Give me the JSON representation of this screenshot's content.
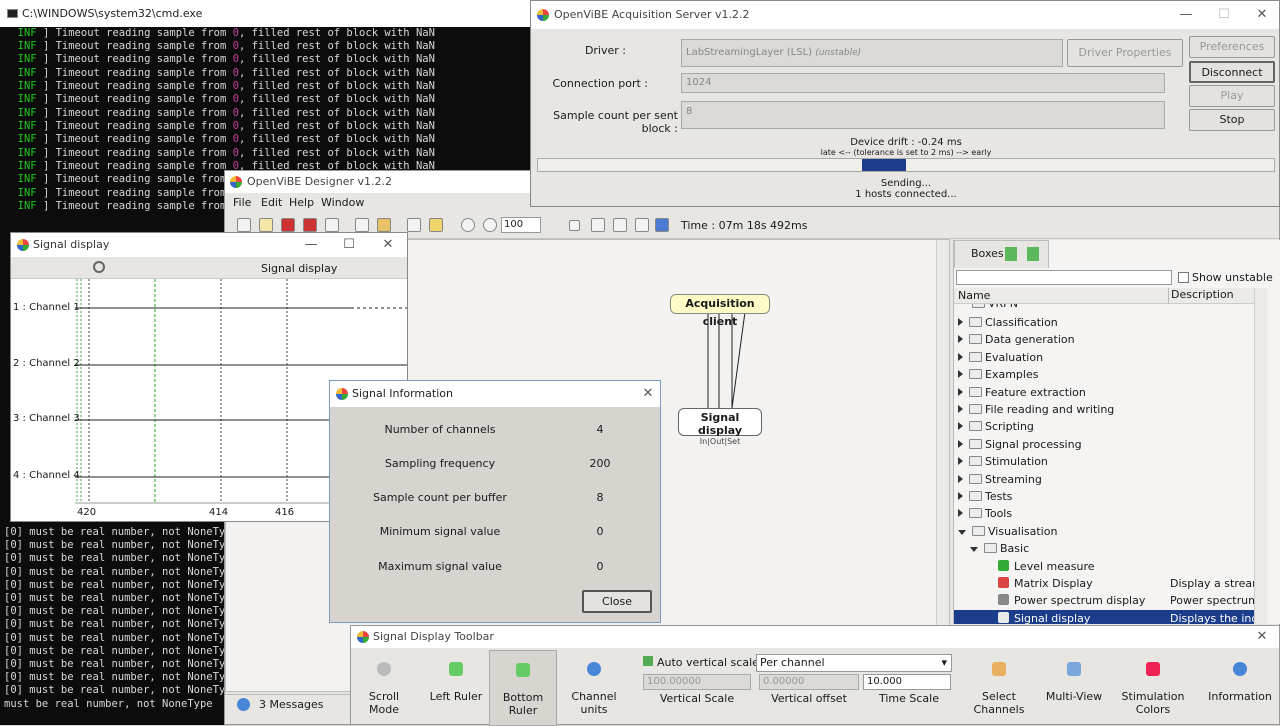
{
  "cmd": {
    "title": "C:\\WINDOWS\\system32\\cmd.exe",
    "inf_lines": [
      "INF",
      "INF",
      "INF",
      "INF",
      "INF",
      "INF",
      "INF",
      "INF",
      "INF",
      "INF",
      "INF",
      "INF",
      "INF",
      "INF"
    ],
    "inf_text_prefix": "] Timeout reading sample from ",
    "inf_text_num": "0",
    "inf_text_suffix": ", filled rest of block with NaN",
    "short_text": "] Timeout reading sample from",
    "err_lines": [
      "[0] must be real number, not NoneType",
      "[0] must be real number, not NoneType",
      "[0] must be real number, not NoneType",
      "[0] must be real number, not NoneType",
      "[0] must be real number, not NoneType",
      "[0] must be real number, not NoneType",
      "[0] must be real number, not NoneType",
      "[0] must be real number, not NoneType",
      "[0] must be real number, not NoneType",
      "[0] must be real number, not NoneType",
      "[0] must be real number, not NoneType",
      "[0] must be real number, not NoneType",
      "[0] must be real number, not NoneType"
    ],
    "last_line": "must be real number, not NoneType"
  },
  "acq": {
    "title": "OpenViBE Acquisition Server v1.2.2",
    "driver_label": "Driver :",
    "driver_value": "LabStreamingLayer (LSL)",
    "driver_tag": "(unstable)",
    "driver_props": "Driver Properties",
    "port_label": "Connection port :",
    "port_value": "1024",
    "sample_label": "Sample count per sent block :",
    "sample_value": "8",
    "preferences": "Preferences",
    "disconnect": "Disconnect",
    "play": "Play",
    "stop": "Stop",
    "drift": "Device drift : -0.24 ms",
    "tolerance": "late <-- (tolerance is set to 2 ms) --> early",
    "sending": "Sending...",
    "hosts": "1 hosts connected..."
  },
  "designer": {
    "title": "OpenViBE Designer v1.2.2",
    "menu": [
      "File",
      "Edit",
      "Help",
      "Window"
    ],
    "zoom": "100",
    "time": "Time : 07m 18s 492ms",
    "messages": "3 Messages",
    "boxes": {
      "acquisition": "Acquisition client",
      "display": "Signal display",
      "display_ports": "In|Out|Set"
    }
  },
  "signal_display": {
    "title": "Signal display",
    "header": "Signal display",
    "channels": [
      "1 : Channel 1",
      "2 : Channel 2",
      "3 : Channel 3",
      "4 : Channel 4"
    ],
    "ticks": [
      "420",
      "414",
      "416"
    ]
  },
  "signal_info": {
    "title": "Signal Information",
    "rows": [
      {
        "label": "Number of channels",
        "value": "4"
      },
      {
        "label": "Sampling frequency",
        "value": "200"
      },
      {
        "label": "Sample count per buffer",
        "value": "8"
      },
      {
        "label": "Minimum signal value",
        "value": "0"
      },
      {
        "label": "Maximum signal value",
        "value": "0"
      }
    ],
    "close": "Close"
  },
  "boxes_panel": {
    "tab": "Boxes",
    "show_unstable": "Show unstable",
    "col_name": "Name",
    "col_desc": "Description",
    "partial_item": "VRPN",
    "items": [
      "Classification",
      "Data generation",
      "Evaluation",
      "Examples",
      "Feature extraction",
      "File reading and writing",
      "Scripting",
      "Signal processing",
      "Stimulation",
      "Streaming",
      "Tests",
      "Tools",
      "Visualisation"
    ],
    "basic": "Basic",
    "leaves": [
      {
        "name": "Level measure",
        "desc": ""
      },
      {
        "name": "Matrix Display",
        "desc": "Display a stream"
      },
      {
        "name": "Power spectrum display",
        "desc": "Power spectrum i"
      },
      {
        "name": "Signal display",
        "desc": "Displays the inco"
      }
    ]
  },
  "toolbar": {
    "title": "Signal Display Toolbar",
    "scroll_mode": "Scroll Mode",
    "left_ruler": "Left Ruler",
    "bottom_ruler": "Bottom Ruler",
    "channel_units": "Channel units",
    "auto_vs": "Auto vertical scale :",
    "per_channel": "Per channel",
    "vs_value": "100.00000",
    "vs_label": "Vertical Scale",
    "vo_value": "0.00000",
    "vo_label": "Vertical offset",
    "ts_value": "10.000",
    "ts_label": "Time Scale",
    "select_channels": "Select Channels",
    "multi_view": "Multi-View",
    "stim_colors": "Stimulation Colors",
    "information": "Information"
  }
}
